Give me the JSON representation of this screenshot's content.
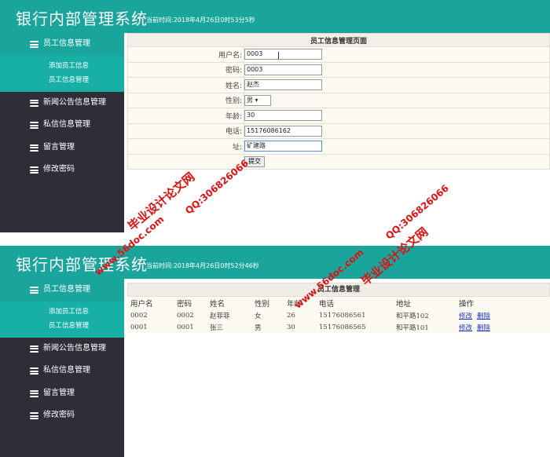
{
  "top_panel": {
    "title": "银行内部管理系统",
    "time": "当前时间:2018年4月26日0时53分5秒",
    "menu": {
      "employee": "员工信息管理",
      "sub_add": "添加员工信息",
      "sub_manage": "员工信息管理",
      "news": "新闻公告信息管理",
      "private": "私信信息管理",
      "message": "留言管理",
      "password": "修改密码"
    },
    "form": {
      "heading": "员工信息管理页面",
      "username_label": "用户名:",
      "username_value": "0003",
      "password_label": "密码:",
      "password_value": "0003",
      "name_label": "姓名:",
      "name_value": "赵杰",
      "gender_label": "性别:",
      "gender_value": "男",
      "age_label": "年龄:",
      "age_value": "30",
      "phone_label": "电话:",
      "phone_value": "15176086162",
      "address_label": "址:",
      "address_value": "矿建路",
      "submit_label": "提交"
    }
  },
  "bottom_panel": {
    "title": "银行内部管理系统",
    "time": "当前时间:2018年4月26日0时52分46秒",
    "menu": {
      "employee": "员工信息管理",
      "sub_add": "添加员工信息",
      "sub_manage": "员工信息管理",
      "news": "新闻公告信息管理",
      "private": "私信信息管理",
      "message": "留言管理",
      "password": "修改密码"
    },
    "list": {
      "heading": "员工信息管理",
      "columns": [
        "用户名",
        "密码",
        "姓名",
        "性别",
        "年龄",
        "电话",
        "地址",
        "操作"
      ],
      "rows": [
        {
          "username": "0002",
          "password": "0002",
          "name": "赵菲菲",
          "gender": "女",
          "age": "26",
          "phone": "15176086561",
          "address": "和平路102",
          "edit": "修改",
          "delete": "删除"
        },
        {
          "username": "0001",
          "password": "0001",
          "name": "张三",
          "gender": "男",
          "age": "30",
          "phone": "15176086565",
          "address": "和平路101",
          "edit": "修改",
          "delete": "删除"
        }
      ]
    }
  },
  "watermark": {
    "site": "www.56doc.com",
    "qq": "QQ:306826066",
    "brand": "毕业设计论文网"
  }
}
